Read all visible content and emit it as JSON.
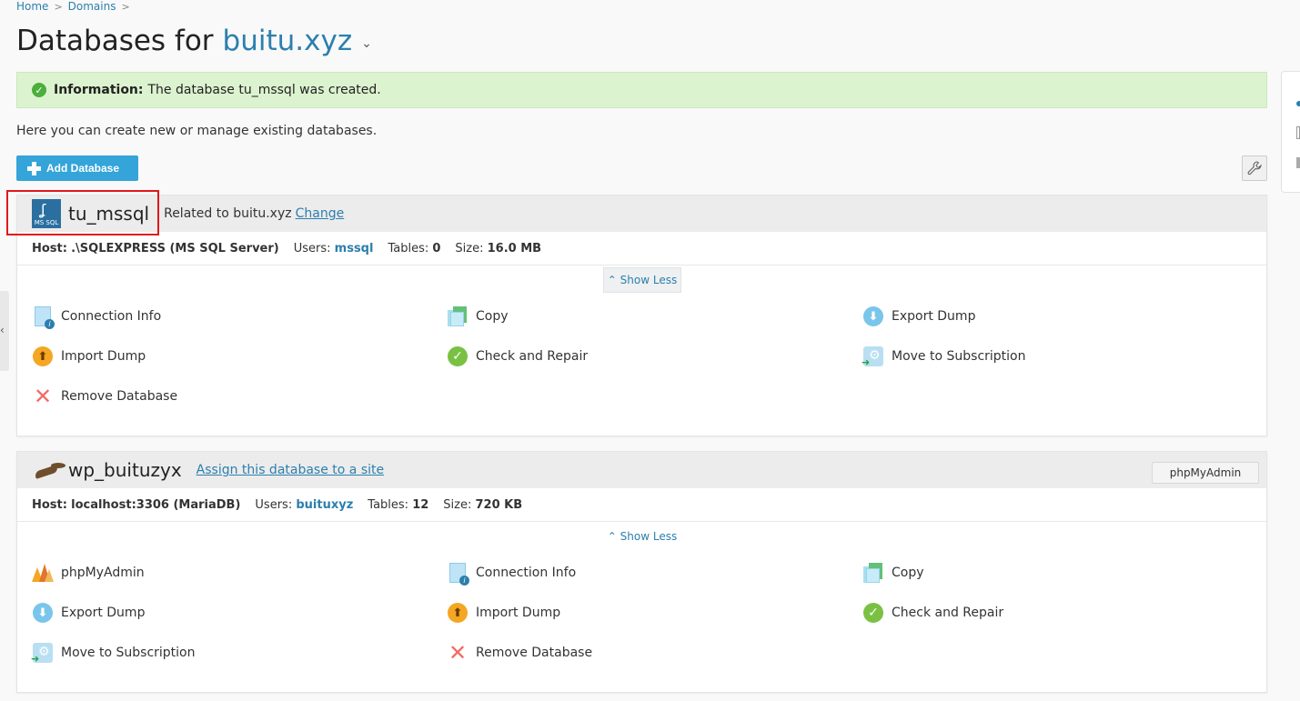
{
  "breadcrumb": {
    "home": "Home",
    "domains": "Domains",
    "sep": ">"
  },
  "title": {
    "prefix": "Databases for",
    "domain": "buitu.xyz",
    "caret": "⌄"
  },
  "info": {
    "label": "Information:",
    "text": "The database tu_mssql was created."
  },
  "intro": "Here you can create new or manage existing databases.",
  "add_button": "Add Database",
  "colors": {
    "accent": "#2c7fae",
    "button": "#34a4d9",
    "success_bg": "#dcf3cf",
    "highlight": "#e0181b"
  },
  "db1": {
    "name": "tu_mssql",
    "related_text": "Related to buitu.xyz",
    "change": "Change",
    "host_label": "Host:",
    "host": ".\\SQLEXPRESS (MS SQL Server)",
    "users_label": "Users:",
    "users": "mssql",
    "tables_label": "Tables:",
    "tables": "0",
    "size_label": "Size:",
    "size": "16.0 MB",
    "show_less": "Show Less",
    "icon": "mssql-icon",
    "icon_text": "MS SQL",
    "actions": {
      "connection_info": "Connection Info",
      "copy": "Copy",
      "export_dump": "Export Dump",
      "import_dump": "Import Dump",
      "check_repair": "Check and Repair",
      "move_subscription": "Move to Subscription",
      "remove": "Remove Database"
    }
  },
  "db2": {
    "name": "wp_buituzyx",
    "assign": "Assign this database to a site",
    "phpmyadmin_button": "phpMyAdmin",
    "host_label": "Host:",
    "host": "localhost:3306 (MariaDB)",
    "users_label": "Users:",
    "users": "buituxyz",
    "tables_label": "Tables:",
    "tables": "12",
    "size_label": "Size:",
    "size": "720 KB",
    "show_less": "Show Less",
    "icon": "mariadb-seal-icon",
    "actions": {
      "phpmyadmin": "phpMyAdmin",
      "connection_info": "Connection Info",
      "copy": "Copy",
      "export_dump": "Export Dump",
      "import_dump": "Import Dump",
      "check_repair": "Check and Repair",
      "move_subscription": "Move to Subscription",
      "remove": "Remove Database"
    }
  }
}
